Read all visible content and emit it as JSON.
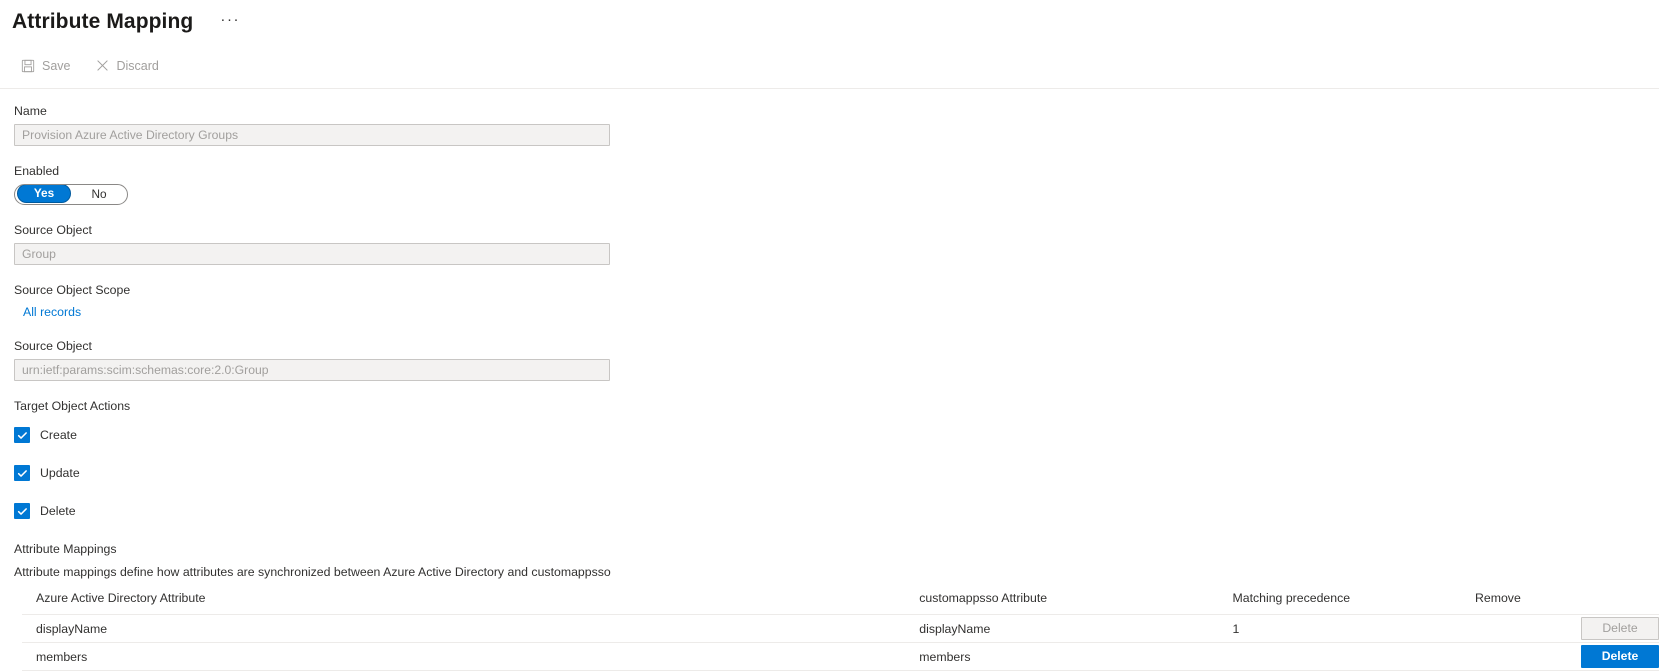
{
  "header": {
    "title": "Attribute Mapping",
    "more_menu": "···"
  },
  "toolbar": {
    "save_label": "Save",
    "discard_label": "Discard",
    "save_icon": "save-floppy-icon",
    "discard_icon": "close-x-icon"
  },
  "form": {
    "name": {
      "label": "Name",
      "value": "Provision Azure Active Directory Groups"
    },
    "enabled": {
      "label": "Enabled",
      "yes_label": "Yes",
      "no_label": "No",
      "selected": "Yes"
    },
    "source_object": {
      "label": "Source Object",
      "value": "Group"
    },
    "source_object_scope": {
      "label": "Source Object Scope",
      "link_text": "All records"
    },
    "source_object_schema": {
      "label": "Source Object",
      "value": "urn:ietf:params:scim:schemas:core:2.0:Group"
    },
    "target_object_actions": {
      "label": "Target Object Actions",
      "actions": [
        {
          "label": "Create",
          "checked": true
        },
        {
          "label": "Update",
          "checked": true
        },
        {
          "label": "Delete",
          "checked": true
        }
      ]
    }
  },
  "mappings": {
    "title": "Attribute Mappings",
    "description": "Attribute mappings define how attributes are synchronized between Azure Active Directory and customappsso",
    "columns": [
      "Azure Active Directory Attribute",
      "customappsso Attribute",
      "Matching precedence",
      "Remove"
    ],
    "rows": [
      {
        "source": "displayName",
        "target": "displayName",
        "precedence": "1",
        "remove_label": "Delete",
        "remove_state": "disabled"
      },
      {
        "source": "members",
        "target": "members",
        "precedence": "",
        "remove_label": "Delete",
        "remove_state": "primary"
      }
    ]
  },
  "colors": {
    "accent": "#0078d4",
    "link": "#0078d4",
    "disabled_text": "#a19f9d",
    "border": "#c8c6c4",
    "row_divider": "#edebe9"
  }
}
